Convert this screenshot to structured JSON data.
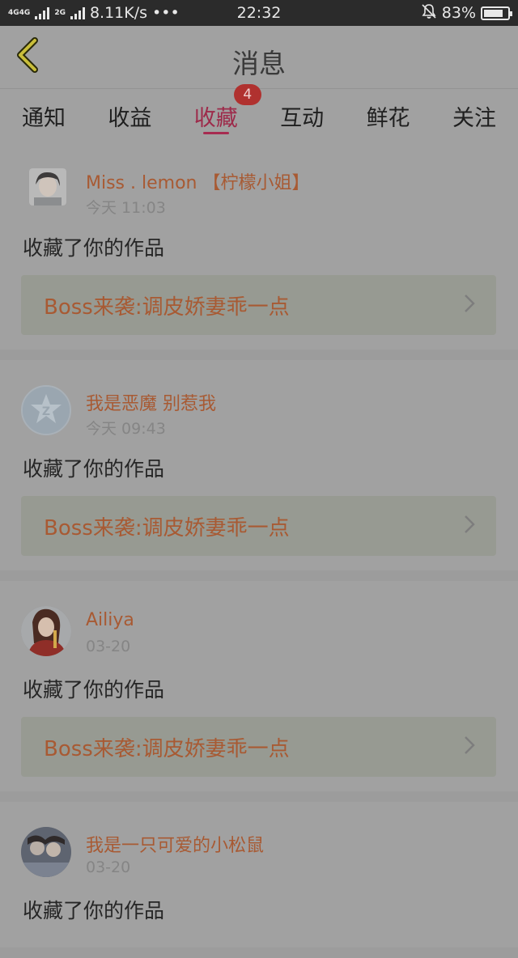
{
  "status_bar": {
    "net_left": "4G",
    "net_left2": "4G",
    "net_right": "2G",
    "speed": "8.11K/s",
    "more": "•••",
    "time": "22:32",
    "battery": "83%",
    "battery_level": 0.83
  },
  "header": {
    "title": "消息",
    "back_icon": "chevron-left-icon"
  },
  "tabs": [
    {
      "label": "通知"
    },
    {
      "label": "收益"
    },
    {
      "label": "收藏",
      "active": true,
      "badge": "4"
    },
    {
      "label": "互动"
    },
    {
      "label": "鲜花"
    },
    {
      "label": "关注"
    }
  ],
  "items": [
    {
      "name": "Miss . lemon 【柠檬小姐】",
      "time": "今天 11:03",
      "action": "收藏了你的作品",
      "work": "Boss来袭:调皮娇妻乖一点"
    },
    {
      "name": "我是恶魔 别惹我",
      "time": "今天 09:43",
      "action": "收藏了你的作品",
      "work": "Boss来袭:调皮娇妻乖一点"
    },
    {
      "name": "Ailiya",
      "time": "03-20",
      "action": "收藏了你的作品",
      "work": "Boss来袭:调皮娇妻乖一点"
    },
    {
      "name": "我是一只可爱的小松鼠",
      "time": "03-20",
      "action": "收藏了你的作品",
      "work": ""
    }
  ],
  "colors": {
    "accent": "#a72b50",
    "name_color": "#a85a33",
    "badge": "#b0312f",
    "status_bar": "#2b2b2b"
  }
}
